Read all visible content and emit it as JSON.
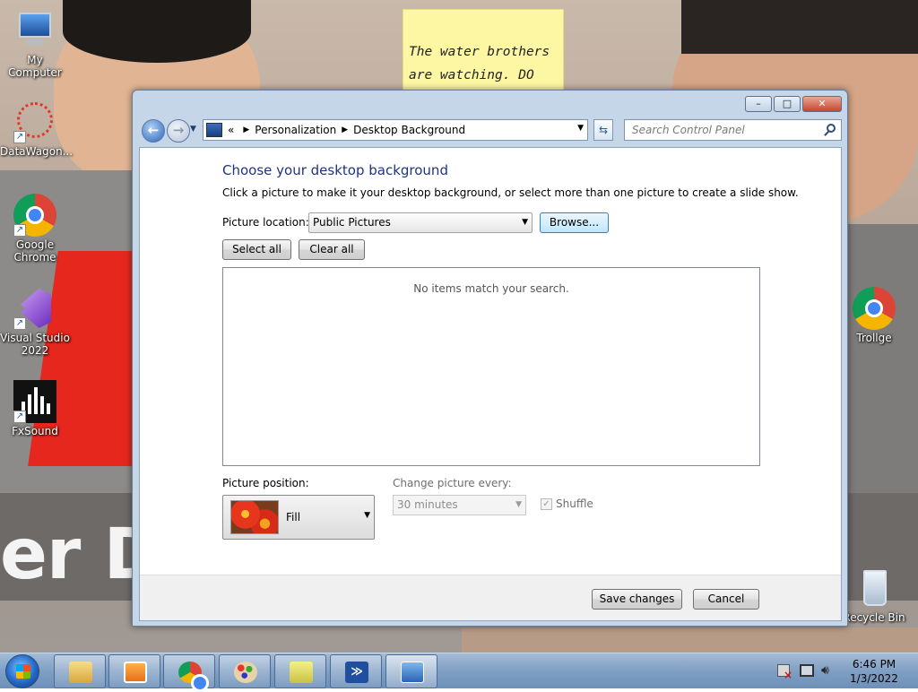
{
  "desktop": {
    "note_text": "The water brothers are watching. DO",
    "banner_text": "er D",
    "icons": [
      {
        "label": "My Computer"
      },
      {
        "label": "DataWagon..."
      },
      {
        "label": "Google Chrome"
      },
      {
        "label": "Visual Studio 2022"
      },
      {
        "label": "FxSound"
      },
      {
        "label": "Trollge"
      },
      {
        "label": "Recycle Bin"
      }
    ]
  },
  "window": {
    "caption_buttons": {
      "minimize": "–",
      "maximize": "□",
      "close": "✕"
    },
    "nav": {
      "back_glyph": "←",
      "forward_glyph": "→",
      "breadcrumb_prefix": "«",
      "breadcrumb": [
        "Personalization",
        "Desktop Background"
      ],
      "search_placeholder": "Search Control Panel"
    },
    "heading": "Choose your desktop background",
    "subtext": "Click a picture to make it your desktop background, or select more than one picture to create a slide show.",
    "picture_location": {
      "label": "Picture location:",
      "value": "Public Pictures"
    },
    "browse_label": "Browse...",
    "select_all_label": "Select all",
    "clear_all_label": "Clear all",
    "empty_message": "No items match your search.",
    "picture_position": {
      "label": "Picture position:",
      "value": "Fill"
    },
    "change_picture": {
      "label": "Change picture every:",
      "value": "30 minutes",
      "enabled": false
    },
    "shuffle": {
      "label": "Shuffle",
      "checked": true,
      "enabled": false
    },
    "save_label": "Save changes",
    "cancel_label": "Cancel"
  },
  "taskbar": {
    "items": [
      "file-explorer",
      "media-player",
      "google-chrome",
      "paint",
      "sticky-notes",
      "powershell",
      "control-panel"
    ],
    "clock_time": "6:46 PM",
    "clock_date": "1/3/2022"
  },
  "colors": {
    "heading": "#1e3287",
    "wallpaper_red": "#e6271d",
    "note_yellow": "#fdf7a3"
  }
}
